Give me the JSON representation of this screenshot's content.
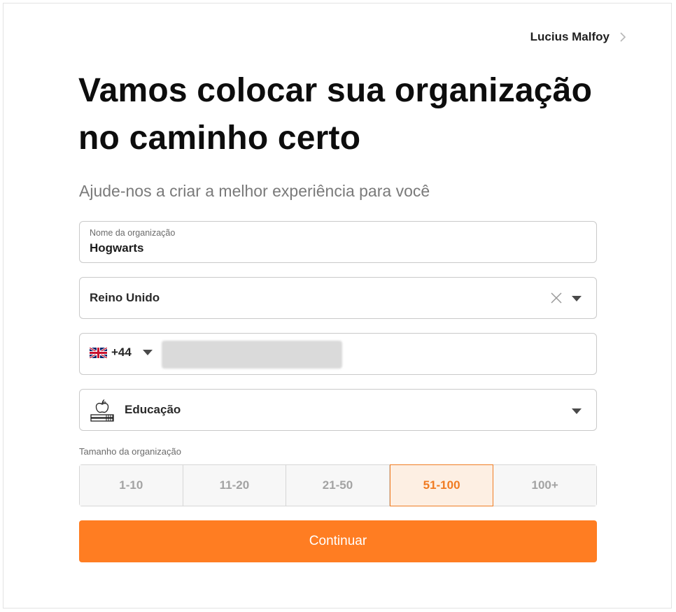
{
  "header": {
    "user_name": "Lucius Malfoy"
  },
  "title": "Vamos colocar sua organização no caminho certo",
  "subtitle": "Ajude-nos a criar a melhor experiência para você",
  "org_field": {
    "label": "Nome da organização",
    "value": "Hogwarts"
  },
  "country_field": {
    "value": "Reino Unido"
  },
  "phone_field": {
    "country_flag": "uk-flag-icon",
    "dial_code": "+44",
    "value": ""
  },
  "industry_field": {
    "icon": "education-icon",
    "value": "Educação"
  },
  "org_size": {
    "label": "Tamanho da organização",
    "options": [
      "1-10",
      "11-20",
      "21-50",
      "51-100",
      "100+"
    ],
    "selected": "51-100"
  },
  "continue_label": "Continuar",
  "colors": {
    "accent": "#ff7d22",
    "selected_bg": "#fdefe3",
    "selected_text": "#f07b22"
  }
}
